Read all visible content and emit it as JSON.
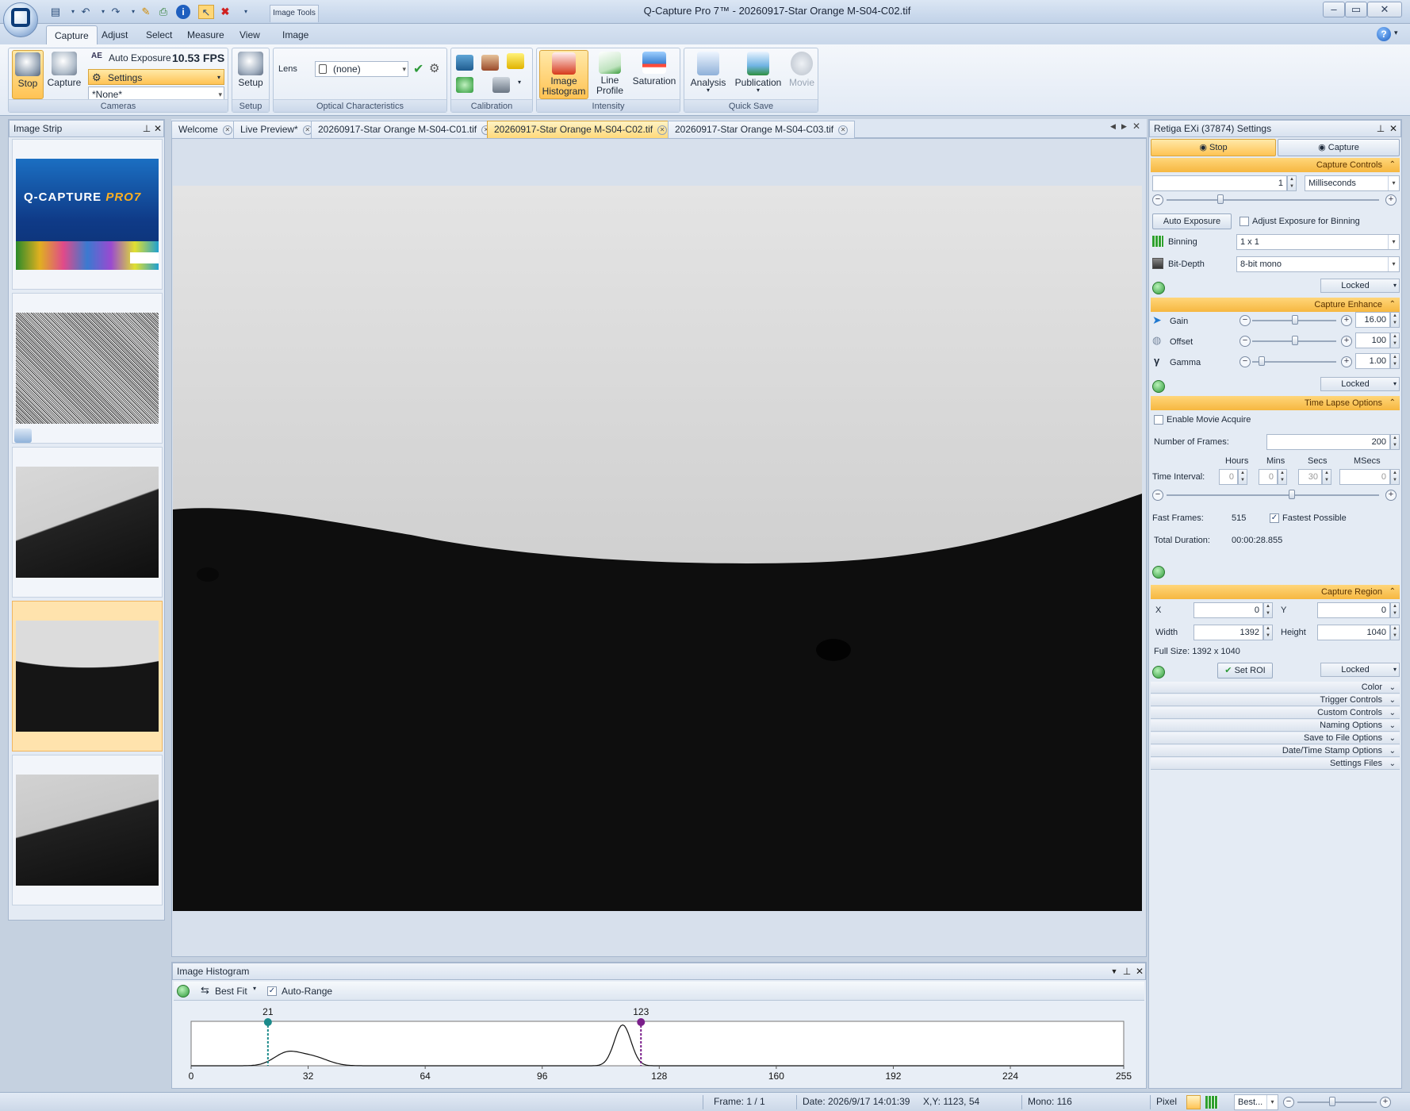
{
  "window": {
    "title": "Q-Capture Pro 7™ - 20260917-Star Orange M-S04-C02.tif",
    "context_tab": "Image Tools",
    "buttons": {
      "minimize": "–",
      "maximize": "▭",
      "close": "✕"
    }
  },
  "ribbon_tabs": [
    "Capture",
    "Adjust",
    "Select",
    "Measure",
    "View",
    "Image"
  ],
  "ribbon": {
    "cameras": {
      "stop_label": "Stop",
      "capture_label": "Capture",
      "auto_exposure_label": "Auto Exposure",
      "fps": "10.53 FPS",
      "settings_label": "Settings",
      "preset_value": "*None*",
      "group_label": "Cameras"
    },
    "setup": {
      "button_label": "Setup",
      "group_label": "Setup"
    },
    "optical": {
      "lens_label": "Lens",
      "lens_value": "(none)",
      "group_label": "Optical Characteristics"
    },
    "calibration": {
      "group_label": "Calibration"
    },
    "intensity": {
      "image_histogram_label": "Image Histogram",
      "line_profile_label": "Line Profile",
      "saturation_label": "Saturation",
      "group_label": "Intensity"
    },
    "quicksave": {
      "analysis_label": "Analysis",
      "publication_label": "Publication",
      "movie_label": "Movie",
      "group_label": "Quick Save"
    }
  },
  "image_strip": {
    "title": "Image Strip"
  },
  "doc_tabs": [
    {
      "label": "Welcome",
      "active": false
    },
    {
      "label": "Live Preview*",
      "active": false
    },
    {
      "label": "20260917-Star Orange M-S04-C01.tif",
      "active": false
    },
    {
      "label": "20260917-Star Orange M-S04-C02.tif",
      "active": true
    },
    {
      "label": "20260917-Star Orange M-S04-C03.tif",
      "active": false
    }
  ],
  "splash": {
    "brand": "Q-CAPTURE",
    "product": "PRO7"
  },
  "histogram": {
    "title": "Image Histogram",
    "best_fit_label": "Best Fit",
    "auto_range_label": "Auto-Range",
    "auto_range_checked": true,
    "x_ticks": [
      "0",
      "32",
      "64",
      "96",
      "128",
      "160",
      "192",
      "224",
      "255"
    ],
    "black_point": 21,
    "white_point": 123,
    "black_point_label": "21",
    "white_point_label": "123",
    "black_color": "#1b8a8a",
    "white_color": "#7a1e8a"
  },
  "settings": {
    "title": "Retiga EXi (37874) Settings",
    "stop_label": "Stop",
    "capture_label": "Capture",
    "capture_controls": {
      "header": "Capture Controls",
      "exposure_value": "1",
      "exposure_unit": "Milliseconds",
      "auto_exposure_label": "Auto Exposure",
      "adjust_binning_label": "Adjust Exposure for Binning",
      "binning_label": "Binning",
      "binning_value": "1 x 1",
      "bitdepth_label": "Bit-Depth",
      "bitdepth_value": "8-bit mono",
      "locked_label": "Locked"
    },
    "capture_enhance": {
      "header": "Capture Enhance",
      "gain_label": "Gain",
      "gain_value": "16.00",
      "offset_label": "Offset",
      "offset_value": "100",
      "gamma_label": "Gamma",
      "gamma_value": "1.00",
      "locked_label": "Locked"
    },
    "time_lapse": {
      "header": "Time Lapse Options",
      "enable_movie_label": "Enable Movie Acquire",
      "num_frames_label": "Number of  Frames:",
      "num_frames_value": "200",
      "hours_label": "Hours",
      "mins_label": "Mins",
      "secs_label": "Secs",
      "msecs_label": "MSecs",
      "interval_label": "Time Interval:",
      "hours_value": "0",
      "mins_value": "0",
      "secs_value": "30",
      "msecs_value": "0",
      "fast_frames_label": "Fast Frames:",
      "fast_frames_value": "515",
      "fastest_possible_label": "Fastest Possible",
      "total_duration_label": "Total Duration:",
      "total_duration_value": "00:00:28.855"
    },
    "capture_region": {
      "header": "Capture Region",
      "x_label": "X",
      "x_value": "0",
      "y_label": "Y",
      "y_value": "0",
      "width_label": "Width",
      "width_value": "1392",
      "height_label": "Height",
      "height_value": "1040",
      "full_size": "Full Size: 1392 x 1040",
      "set_roi_label": "Set ROI",
      "locked_label": "Locked"
    },
    "collapsed": [
      "Color",
      "Trigger Controls",
      "Custom Controls",
      "Naming Options",
      "Save to File Options",
      "Date/Time Stamp Options",
      "Settings Files"
    ]
  },
  "status": {
    "frame": "Frame: 1 / 1",
    "date": "Date: 2026/9/17 14:01:39",
    "xy": "X,Y: 1123,    54",
    "mono": "Mono:   116",
    "pixel": "Pixel",
    "zoom": "Best..."
  }
}
